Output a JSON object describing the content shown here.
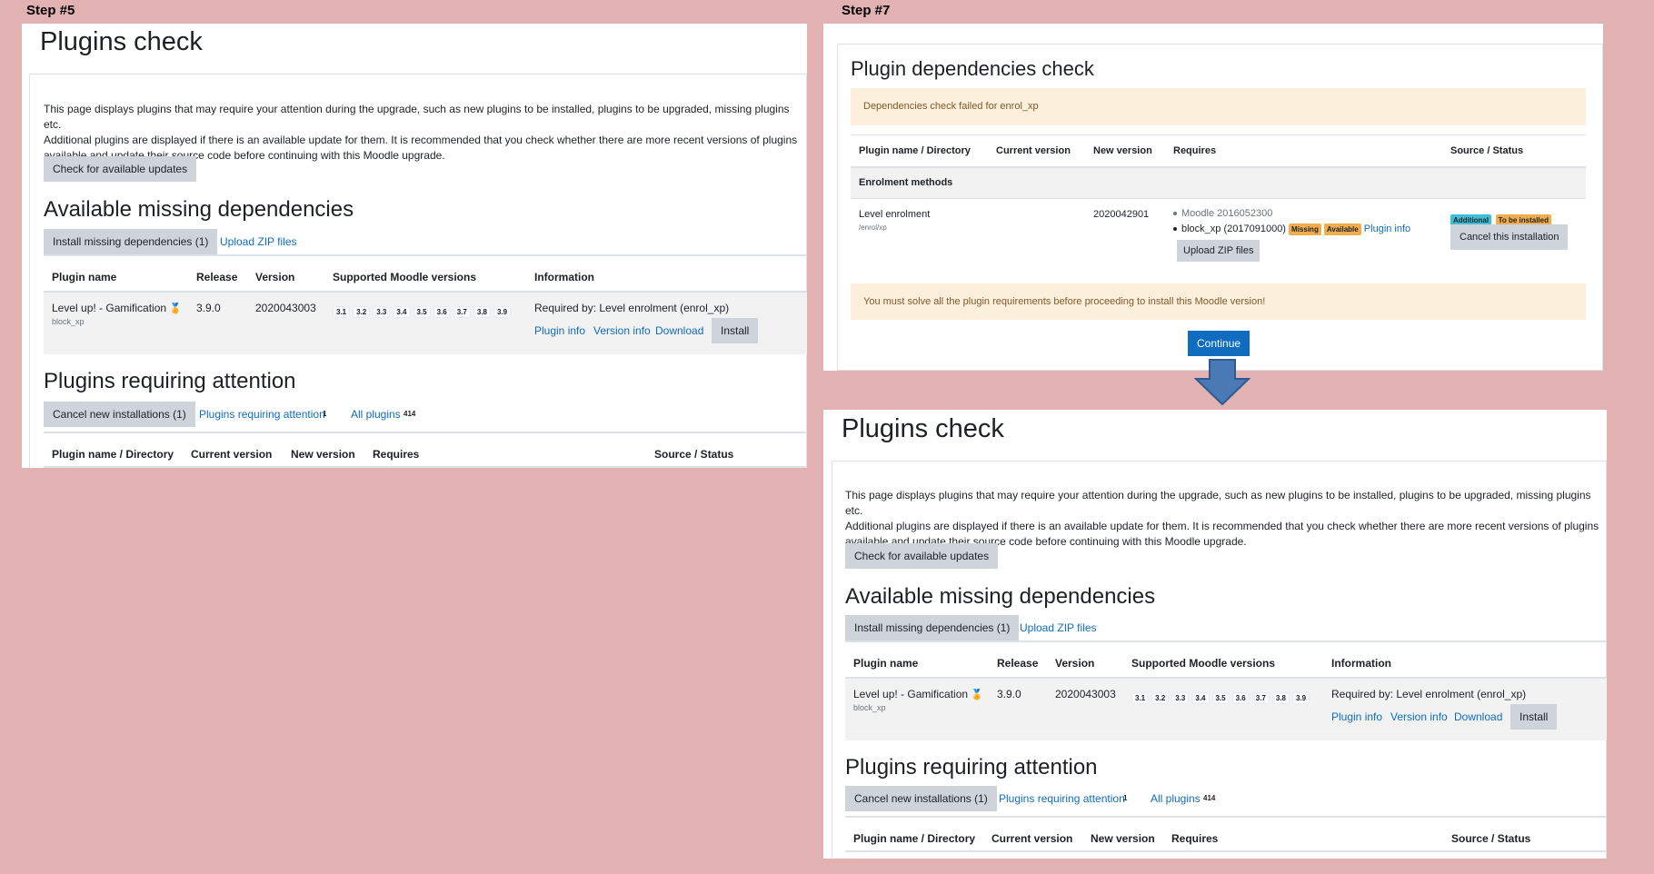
{
  "step5": {
    "label": "Step #5",
    "plugins_check": {
      "title": "Plugins check",
      "intro": [
        "This page displays plugins that may require your attention during the upgrade, such as new plugins to be installed, plugins to be upgraded, missing plugins etc.",
        "Additional plugins are displayed if there is an available update for them. It is recommended that you check whether there are more recent versions of plugins",
        "available and update their source code before continuing with this Moodle upgrade."
      ],
      "check_updates": "Check for available updates",
      "missing_deps_title": "Available missing dependencies",
      "install_missing": "Install missing dependencies (1)",
      "upload_zip": "Upload ZIP files",
      "table_headers": [
        "Plugin name",
        "Release",
        "Version",
        "Supported Moodle versions",
        "Information"
      ],
      "row": {
        "name": "Level up! - Gamification",
        "component": "block_xp",
        "release": "3.9.0",
        "version": "2020043003",
        "moodle_versions": [
          "3.1",
          "3.2",
          "3.3",
          "3.4",
          "3.5",
          "3.6",
          "3.7",
          "3.8",
          "3.9"
        ],
        "required_by": "Required by: Level enrolment (enrol_xp)",
        "plugin_info": "Plugin info",
        "version_info": "Version info",
        "download": "Download",
        "install": "Install"
      },
      "attention_title": "Plugins requiring attention",
      "cancel_new": "Cancel new installations (1)",
      "plugins_requiring_attention": "Plugins requiring attention",
      "attention_count": "1",
      "all_plugins": "All plugins",
      "all_count": "414",
      "attention_headers": [
        "Plugin name / Directory",
        "Current version",
        "New version",
        "Requires",
        "Source / Status"
      ]
    }
  },
  "step7": {
    "label": "Step #7",
    "title": "Plugin dependencies check",
    "alert_failed": "Dependencies check failed for enrol_xp",
    "headers": [
      "Plugin name / Directory",
      "Current version",
      "New version",
      "Requires",
      "Source / Status"
    ],
    "group": "Enrolment methods",
    "row": {
      "name": "Level enrolment",
      "dir": "/enrol/xp",
      "new_version": "2020042901",
      "req1": "Moodle 2016052300",
      "req2": "block_xp (2017091000)",
      "badge_missing": "Missing",
      "badge_available": "Available",
      "plugin_info": "Plugin info",
      "upload_zip": "Upload ZIP files",
      "badge_additional": "Additional",
      "badge_to_install": "To be installed",
      "cancel_install": "Cancel this installation"
    },
    "alert_solve": "You must solve all the plugin requirements before proceeding to install this Moodle version!",
    "continue": "Continue"
  },
  "colors": {
    "background": "#e2b2b2",
    "link": "#0f6cbf",
    "primary": "#0f6cbf",
    "arrow": "#4a7ab6",
    "warning_bg": "#fcefdc"
  }
}
